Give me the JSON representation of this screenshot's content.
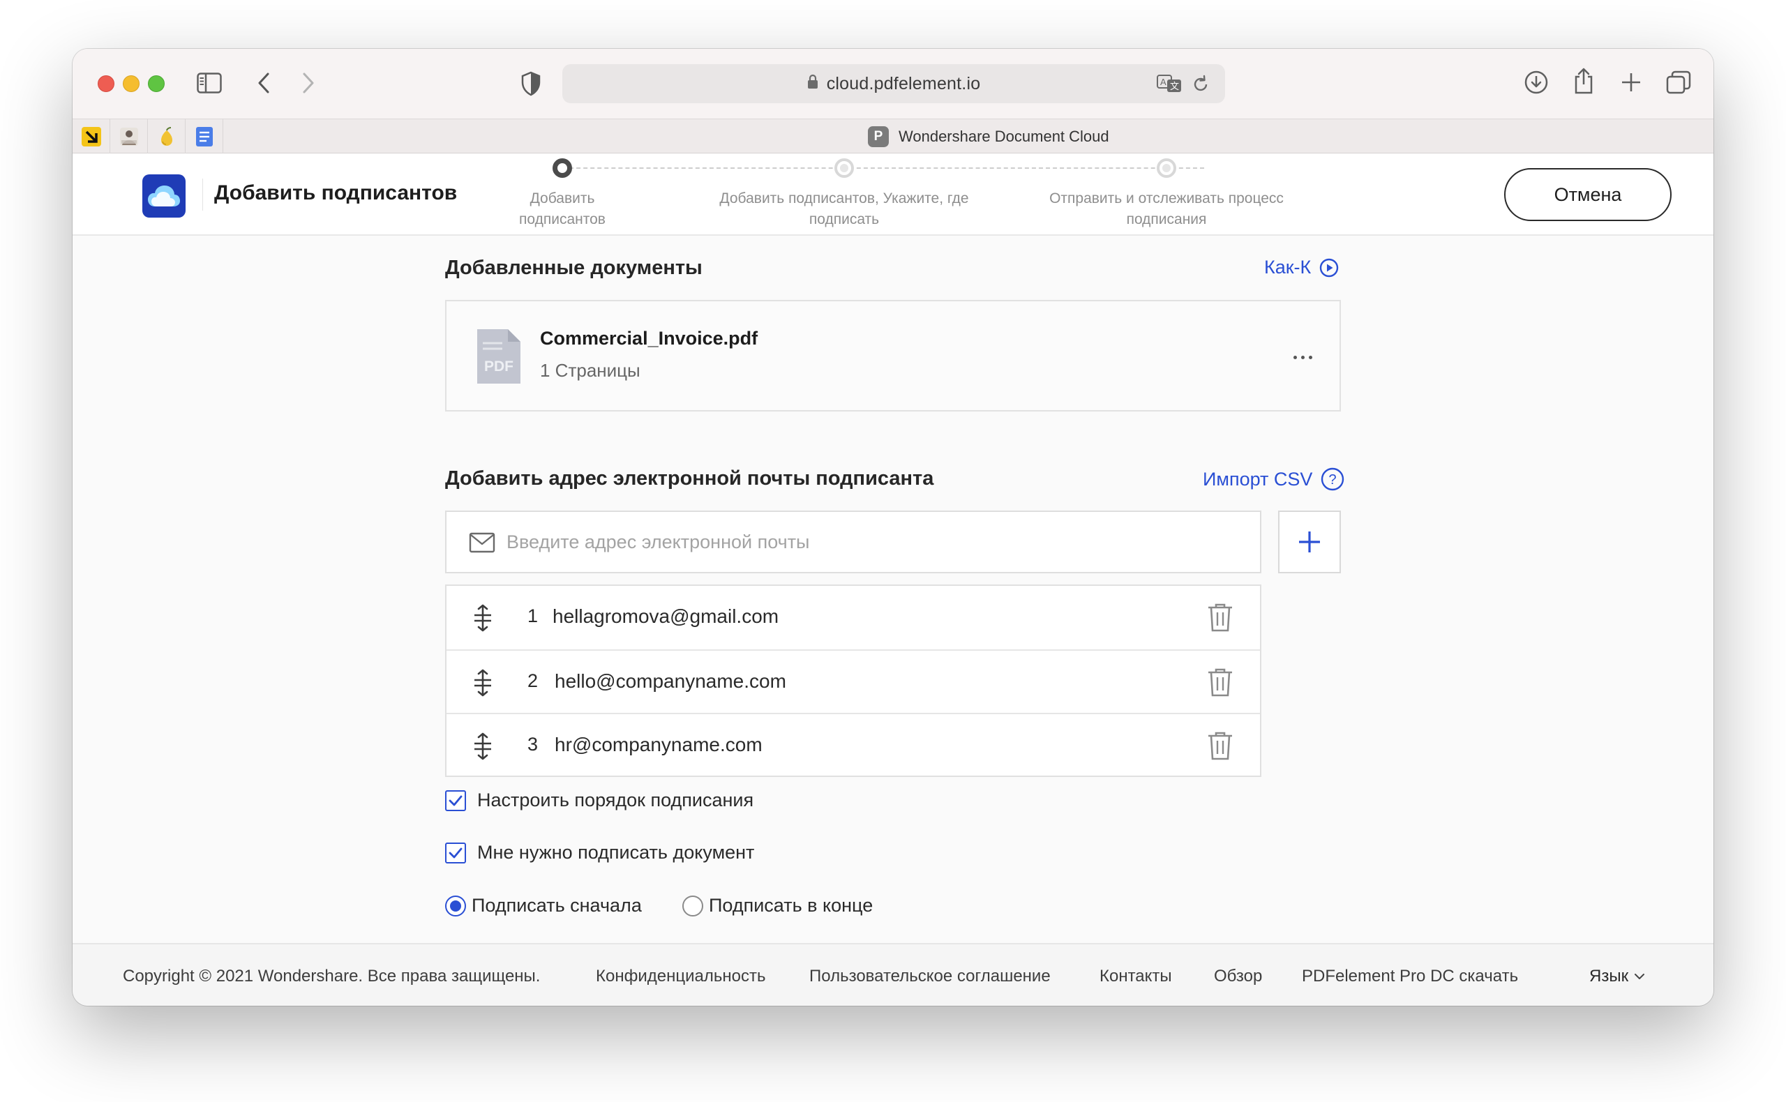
{
  "browser": {
    "url": "cloud.pdfelement.io",
    "tab_title": "Wondershare Document Cloud",
    "tab_favicon_letter": "P",
    "favorites": [
      "arrow-app-icon",
      "photo-app-icon",
      "pear-app-icon",
      "docs-app-icon"
    ]
  },
  "header": {
    "title": "Добавить подписантов",
    "steps": [
      {
        "label_line1": "Добавить",
        "label_line2": "подписантов",
        "state": "active"
      },
      {
        "label_line1": "Добавить подписантов, Укажите, где",
        "label_line2": "подписать",
        "state": "inactive"
      },
      {
        "label_line1": "Отправить и отслеживать процесс",
        "label_line2": "подписания",
        "state": "inactive"
      }
    ],
    "cancel_label": "Отмена"
  },
  "documents": {
    "section_title": "Добавленные документы",
    "howto_label": "Как-К",
    "items": [
      {
        "name": "Commercial_Invoice.pdf",
        "pages": "1 Страницы",
        "icon_text": "PDF"
      }
    ]
  },
  "signers": {
    "section_title": "Добавить адрес электронной почты подписанта",
    "import_label": "Импорт CSV",
    "email_placeholder": "Введите адрес электронной почты",
    "email_value": "",
    "list": [
      {
        "num": "1",
        "email": "hellagromova@gmail.com"
      },
      {
        "num": "2",
        "email": "hello@companyname.com"
      },
      {
        "num": "3",
        "email": "hr@companyname.com"
      }
    ]
  },
  "options": {
    "set_order_label": "Настроить порядок подписания",
    "set_order_checked": true,
    "i_sign_label": "Мне нужно подписать документ",
    "i_sign_checked": true,
    "sign_first_label": "Подписать сначала",
    "sign_last_label": "Подписать в конце",
    "selected": "first"
  },
  "footer": {
    "copyright": "Copyright © 2021 Wondershare. Все права защищены.",
    "links": [
      "Конфиденциальность",
      "Пользовательское соглашение",
      "Контакты",
      "Обзор",
      "PDFelement Pro DC скачать"
    ],
    "language_label": "Язык"
  },
  "colors": {
    "accent": "#2a4fd4",
    "logo_bg": "#1f3cb6"
  }
}
